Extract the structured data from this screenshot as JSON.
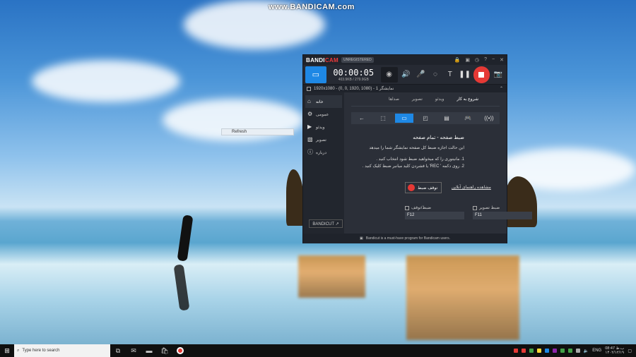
{
  "watermark": "www.BANDICAM.com",
  "desktop_menu": {
    "refresh": "Refresh"
  },
  "app": {
    "logo_a": "BANDI",
    "logo_b": "CAM",
    "registration": "UNREGISTERED",
    "timer": "00:00:05",
    "size_info": "403.9KB / 279.9GB",
    "target": "1920x1080 - (0, 0, 1920, 1080) - نمایشگر 1",
    "sidebar": [
      "خانه",
      "عمومی",
      "ویدئو",
      "تصویر",
      "درباره"
    ],
    "bandicut_label": "BANDICUT ↗",
    "tabs": [
      "شروع به کار",
      "ویدئو",
      "تصویر",
      "صداها"
    ],
    "mode_title": "ضبط صفحه - تمام صفحه",
    "mode_desc": "این حالت اجازه ضبط کل صفحه نمایشگر شما را میدهد",
    "step1": "1. مانیتوری را که میخواهید ضبط شود انتخاب کنید .",
    "step2": "2. روی دکمه ' REC' یا فشردن کلید میانبر ضبط کلیک کنید .",
    "stop_label": "توقف ضبط",
    "help_link": "مشاهده راهنمای آنلاین",
    "hotkey_rec_label": "ضبط/توقف",
    "hotkey_rec": "F12",
    "hotkey_img_label": "ضبط تصویر",
    "hotkey_img": "F11",
    "footer": "Bandicut is a must-have program for Bandicam users."
  },
  "taskbar": {
    "search_placeholder": "Type here to search",
    "lang": "ENG",
    "time": "08:47 ب.ظ",
    "date": "۱۴۰۲/۱۲/۱۹"
  }
}
